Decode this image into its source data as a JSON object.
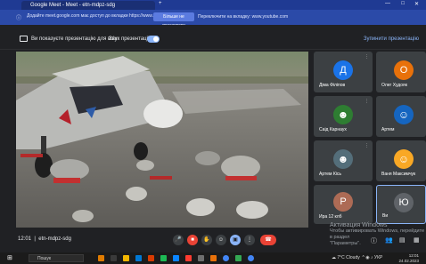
{
  "browser": {
    "tab_title": "Google Meet - Meet - etn-mdpz-sdg",
    "new_tab_label": "+",
    "controls": {
      "minimize": "—",
      "maximize": "□",
      "close": "✕"
    }
  },
  "infobar": {
    "message": "Додайте meet.google.com має доступ до вкладки https://www.youtube.com",
    "allow_label": "Більше не показувати",
    "switch_label": "Переключити на вкладку: www.youtube.com"
  },
  "presentation": {
    "presenting_label": "Ви показуєте презентацію для всіх",
    "share_audio_label": "Звук презентації",
    "stop_label": "Зупинити презентацію",
    "share_audio_on": true
  },
  "participants": [
    {
      "name": "Діма Філіпов",
      "initial": "Д",
      "color": "#1a73e8"
    },
    {
      "name": "Олег Худояк",
      "initial": "О",
      "color": "#e8710a"
    },
    {
      "name": "Саід Карнаух",
      "initial": "",
      "color": "#3c4043"
    },
    {
      "name": "Артем",
      "initial": "",
      "color": "#3c4043"
    },
    {
      "name": "Артем Кісь",
      "initial": "",
      "color": "#3c4043"
    },
    {
      "name": "Ваня Максимчук",
      "initial": "",
      "color": "#3c4043"
    },
    {
      "name": "Ира 12 клб",
      "initial": "Р",
      "color": "#ad6b55"
    },
    {
      "name": "Ви",
      "initial": "Ю",
      "color": "#5f6368"
    }
  ],
  "controls": {
    "time": "12:01",
    "meeting_code": "etn-mdpz-sdg",
    "mic_icon": "mic-icon",
    "cam_icon": "camera-off-icon",
    "hand_icon": "raise-hand-icon",
    "emoji_icon": "emoji-icon",
    "present_icon": "present-icon",
    "more_icon": "more-icon",
    "end_icon": "end-call-icon"
  },
  "windows_activation": {
    "line1": "Активация Windows",
    "line2": "Чтобы активировать Windows, перейдите в раздел",
    "line3": "\"Параметры\"."
  },
  "taskbar": {
    "search_label": "Пошук",
    "weather": "7°C Cloudy",
    "lang": "УКР",
    "time": "12:01",
    "date": "24.02.2023"
  }
}
